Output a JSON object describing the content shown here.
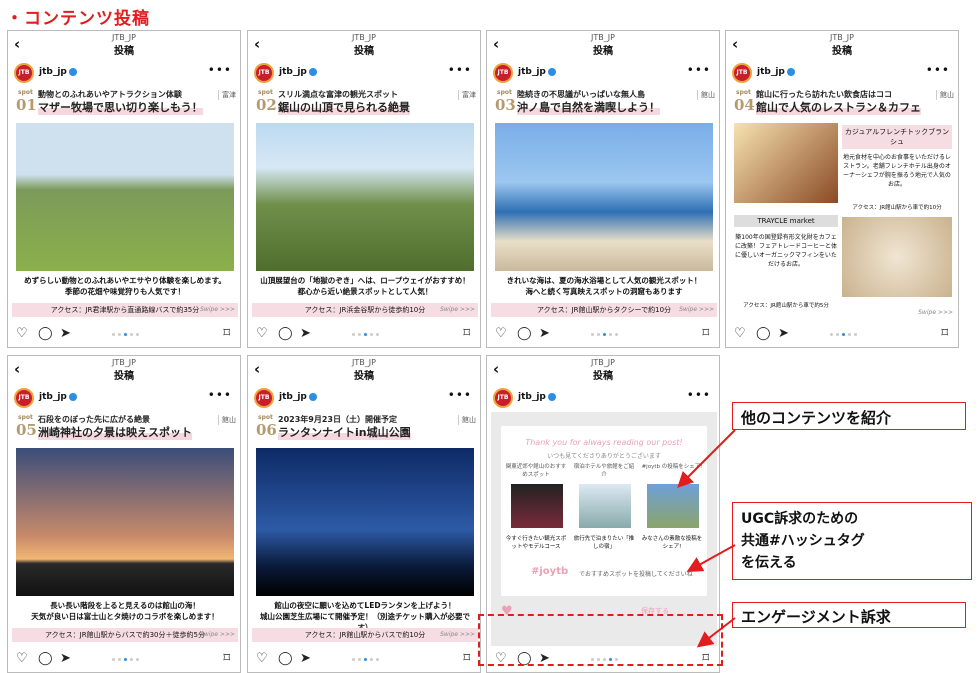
{
  "page_title": "・コンテンツ投稿",
  "common": {
    "account": "JTB_JP",
    "label": "投稿",
    "username": "jtb_jp",
    "logo": "JTB",
    "swipe": "Swipe >>>",
    "spot": "spot"
  },
  "posts": [
    {
      "num": "01",
      "place": "富津",
      "line1": "動物とのふれあいやアトラクション体験",
      "line2": "マザー牧場で思い切り楽しもう！",
      "cap1": "めずらしい動物とのふれあいやエサやり体験を楽しめます。",
      "cap2": "季節の花畑や味覚狩りも人気です！",
      "access": "アクセス：JR君津駅から直通路線バスで約35分"
    },
    {
      "num": "02",
      "place": "富津",
      "line1": "スリル満点な富津の観光スポット",
      "line2": "鋸山の山頂で見られる絶景",
      "cap1": "山頂展望台の「地獄のぞき」へは、ロープウェイがおすすめ！",
      "cap2": "都心から近い絶景スポットとして人気！",
      "access": "アクセス：JR浜金谷駅から徒歩約10分"
    },
    {
      "num": "03",
      "place": "館山",
      "line1": "陸続きの不思議がいっぱいな無人島",
      "line2": "沖ノ島で自然を満喫しよう！",
      "cap1": "きれいな海は、夏の海水浴場として人気の観光スポット！",
      "cap2": "海へと続く写真映えスポットの洞窟もあります",
      "access": "アクセス：JR館山駅からタクシーで約10分"
    },
    {
      "num": "04",
      "place": "館山",
      "line1": "館山に行ったら訪れたい飲食店はココ",
      "line2": "館山で人気のレストラン＆カフェ",
      "box1": "カジュアルフレンチトックブランシュ",
      "text1": "地元食材を中心のお食事をいただけるレストラン。老舗フレンチホテル出身のオーナーシェフが腕を振るう地元で人気のお店。",
      "access1": "アクセス：JR館山駅から車で約10分",
      "box2": "TRAYCLE market",
      "text2": "築100年の国登録有形文化財をカフェに改築！フェアトレードコーヒーと体に優しいオーガニックマフィンをいただけるお店。",
      "access2": "アクセス：JR館山駅から車で約5分"
    },
    {
      "num": "05",
      "place": "館山",
      "line1": "石段をのぼった先に広がる絶景",
      "line2": "洲崎神社の夕景は映えスポット",
      "cap1": "長い長い階段を上ると見えるのは館山の海！",
      "cap2": "天気が良い日は富士山とタ焼けのコラボを楽しめます！",
      "access": "アクセス：JR館山駅からバスで約30分＋徒歩約5分"
    },
    {
      "num": "06",
      "place": "館山",
      "line1": "2023年9月23日（土）開催予定",
      "line2": "ランタンナイトin城山公園",
      "cap1": "館山の夜空に願いを込めてLEDランタンを上げよう！",
      "cap2": "城山公園芝生広場にて開催予定！（別途チケット購入が必要です）",
      "access": "アクセス：JR館山駅からバスで約10分"
    }
  ],
  "ugc": {
    "thanks": "Thank you for always reading our post!",
    "sub": "いつも見てくださりありがとうございます",
    "c1": "関東近郊や館山のおすすめスポット",
    "c2": "宿泊ホテルや旅館をご紹介",
    "c3": "#joytb の投稿をシェア!",
    "m1": "今すぐ行きたい観光スポットやモデルコース",
    "m2": "旅行先で泊まりたい「推しの宿」",
    "m3": "みなさんの素敵な投稿をシェア!",
    "hashtag": "#joytb",
    "hashtag_text": "でおすすめスポットを投稿してくださいね",
    "save": "保存する"
  },
  "callouts": {
    "c1": "他のコンテンツを紹介",
    "c2a": "UGC訴求のための",
    "c2b": "共通#ハッシュタグ",
    "c2c": "を伝える",
    "c3": "エンゲージメント訴求"
  }
}
